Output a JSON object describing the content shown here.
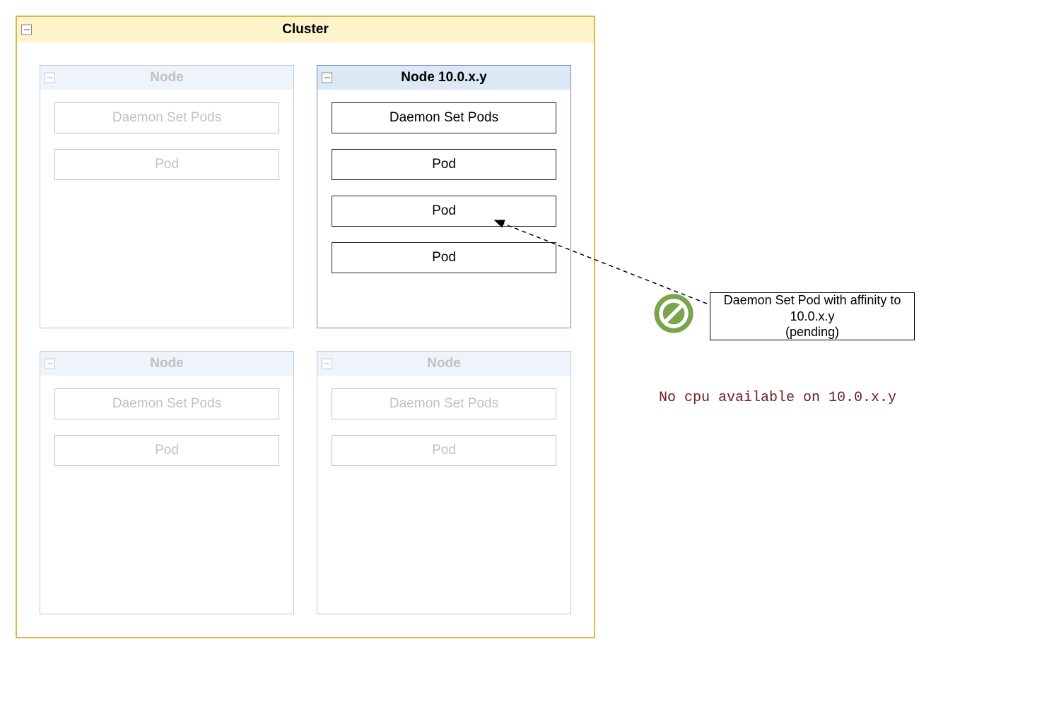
{
  "cluster": {
    "title": "Cluster",
    "nodes": [
      {
        "title": "Node",
        "dimmed": true,
        "pods": [
          "Daemon Set Pods",
          "Pod"
        ]
      },
      {
        "title": "Node 10.0.x.y",
        "dimmed": false,
        "pods": [
          "Daemon Set Pods",
          "Pod",
          "Pod",
          "Pod"
        ]
      },
      {
        "title": "Node",
        "dimmed": true,
        "pods": [
          "Daemon Set Pods",
          "Pod"
        ]
      },
      {
        "title": "Node",
        "dimmed": true,
        "pods": [
          "Daemon Set Pods",
          "Pod"
        ]
      }
    ]
  },
  "pending_pod": {
    "label": "Daemon Set Pod with affinity to 10.0.x.y\n(pending)"
  },
  "error_message": "No cpu available on 10.0.x.y",
  "colors": {
    "cluster_border": "#d9b84a",
    "cluster_header_bg": "#fff3cc",
    "node_border": "#6a8ab3",
    "node_header_bg": "#dde8f6",
    "prohibited": "#7ba54a",
    "error_text": "#6b1e1e"
  }
}
